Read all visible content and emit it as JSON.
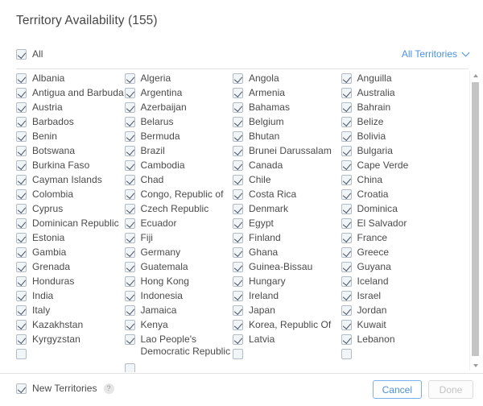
{
  "header": {
    "title": "Territory Availability (155)",
    "all_label": "All",
    "all_checked": true,
    "territories_link": "All Territories",
    "chevron_icon": "chevron-down-icon"
  },
  "footer": {
    "new_territories_label": "New Territories",
    "new_territories_checked": true,
    "help_icon": "help-icon",
    "help_glyph": "?",
    "cancel_label": "Cancel",
    "done_label": "Done",
    "done_disabled": true
  },
  "scrollbar": {
    "up_arrow_icon": "scroll-up-arrow-icon",
    "down_arrow_icon": "scroll-down-arrow-icon"
  },
  "colors": {
    "accent": "#4a90e2",
    "text": "#4a4a4a",
    "title": "#464646",
    "divider": "#e2e2e2",
    "checkbox_fill": "#f2f5f8",
    "checkbox_border": "#b3bcc6",
    "check_mark": "#44505e",
    "scroll_thumb": "#c4c4c4",
    "disabled_text": "#c3c3c3"
  },
  "columns": [
    {
      "items": [
        {
          "label": "Albania",
          "checked": true
        },
        {
          "label": "Antigua and Barbuda",
          "checked": true
        },
        {
          "label": "Austria",
          "checked": true
        },
        {
          "label": "Barbados",
          "checked": true
        },
        {
          "label": "Benin",
          "checked": true
        },
        {
          "label": "Botswana",
          "checked": true
        },
        {
          "label": "Burkina Faso",
          "checked": true
        },
        {
          "label": "Cayman Islands",
          "checked": true
        },
        {
          "label": "Colombia",
          "checked": true
        },
        {
          "label": "Cyprus",
          "checked": true
        },
        {
          "label": "Dominican Republic",
          "checked": true
        },
        {
          "label": "Estonia",
          "checked": true
        },
        {
          "label": "Gambia",
          "checked": true
        },
        {
          "label": "Grenada",
          "checked": true
        },
        {
          "label": "Honduras",
          "checked": true
        },
        {
          "label": "India",
          "checked": true
        },
        {
          "label": "Italy",
          "checked": true
        },
        {
          "label": "Kazakhstan",
          "checked": true
        },
        {
          "label": "Kyrgyzstan",
          "checked": true
        },
        {
          "label": "",
          "checked": true
        }
      ]
    },
    {
      "items": [
        {
          "label": "Algeria",
          "checked": true
        },
        {
          "label": "Argentina",
          "checked": true
        },
        {
          "label": "Azerbaijan",
          "checked": true
        },
        {
          "label": "Belarus",
          "checked": true
        },
        {
          "label": "Bermuda",
          "checked": true
        },
        {
          "label": "Brazil",
          "checked": true
        },
        {
          "label": "Cambodia",
          "checked": true
        },
        {
          "label": "Chad",
          "checked": true
        },
        {
          "label": "Congo, Republic of",
          "checked": true
        },
        {
          "label": "Czech Republic",
          "checked": true
        },
        {
          "label": "Ecuador",
          "checked": true
        },
        {
          "label": "Fiji",
          "checked": true
        },
        {
          "label": "Germany",
          "checked": true
        },
        {
          "label": "Guatemala",
          "checked": true
        },
        {
          "label": "Hong Kong",
          "checked": true
        },
        {
          "label": "Indonesia",
          "checked": true
        },
        {
          "label": "Jamaica",
          "checked": true
        },
        {
          "label": "Kenya",
          "checked": true
        },
        {
          "label": "Lao People's Democratic Republic",
          "checked": true,
          "tall": true
        },
        {
          "label": "",
          "checked": true
        }
      ]
    },
    {
      "items": [
        {
          "label": "Angola",
          "checked": true
        },
        {
          "label": "Armenia",
          "checked": true
        },
        {
          "label": "Bahamas",
          "checked": true
        },
        {
          "label": "Belgium",
          "checked": true
        },
        {
          "label": "Bhutan",
          "checked": true
        },
        {
          "label": "Brunei Darussalam",
          "checked": true
        },
        {
          "label": "Canada",
          "checked": true
        },
        {
          "label": "Chile",
          "checked": true
        },
        {
          "label": "Costa Rica",
          "checked": true
        },
        {
          "label": "Denmark",
          "checked": true
        },
        {
          "label": "Egypt",
          "checked": true
        },
        {
          "label": "Finland",
          "checked": true
        },
        {
          "label": "Ghana",
          "checked": true
        },
        {
          "label": "Guinea-Bissau",
          "checked": true
        },
        {
          "label": "Hungary",
          "checked": true
        },
        {
          "label": "Ireland",
          "checked": true
        },
        {
          "label": "Japan",
          "checked": true
        },
        {
          "label": "Korea, Republic Of",
          "checked": true
        },
        {
          "label": "Latvia",
          "checked": true
        },
        {
          "label": "",
          "checked": true
        }
      ]
    },
    {
      "items": [
        {
          "label": "Anguilla",
          "checked": true
        },
        {
          "label": "Australia",
          "checked": true
        },
        {
          "label": "Bahrain",
          "checked": true
        },
        {
          "label": "Belize",
          "checked": true
        },
        {
          "label": "Bolivia",
          "checked": true
        },
        {
          "label": "Bulgaria",
          "checked": true
        },
        {
          "label": "Cape Verde",
          "checked": true
        },
        {
          "label": "China",
          "checked": true
        },
        {
          "label": "Croatia",
          "checked": true
        },
        {
          "label": "Dominica",
          "checked": true
        },
        {
          "label": "El Salvador",
          "checked": true
        },
        {
          "label": "France",
          "checked": true
        },
        {
          "label": "Greece",
          "checked": true
        },
        {
          "label": "Guyana",
          "checked": true
        },
        {
          "label": "Iceland",
          "checked": true
        },
        {
          "label": "Israel",
          "checked": true
        },
        {
          "label": "Jordan",
          "checked": true
        },
        {
          "label": "Kuwait",
          "checked": true
        },
        {
          "label": "Lebanon",
          "checked": true
        },
        {
          "label": "",
          "checked": true
        }
      ]
    }
  ]
}
